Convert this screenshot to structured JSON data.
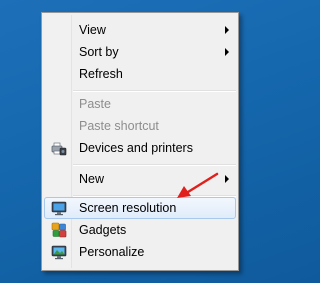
{
  "context_menu": {
    "items": [
      {
        "label": "View",
        "enabled": true,
        "submenu": true
      },
      {
        "label": "Sort by",
        "enabled": true,
        "submenu": true
      },
      {
        "label": "Refresh",
        "enabled": true,
        "submenu": false
      },
      {
        "label": "Paste",
        "enabled": false,
        "submenu": false
      },
      {
        "label": "Paste shortcut",
        "enabled": false,
        "submenu": false
      },
      {
        "label": "Devices and printers",
        "enabled": true,
        "submenu": false,
        "icon": "devices-printers-icon"
      },
      {
        "label": "New",
        "enabled": true,
        "submenu": true
      },
      {
        "label": "Screen resolution",
        "enabled": true,
        "submenu": false,
        "icon": "screen-resolution-icon",
        "highlighted": true
      },
      {
        "label": "Gadgets",
        "enabled": true,
        "submenu": false,
        "icon": "gadgets-icon"
      },
      {
        "label": "Personalize",
        "enabled": true,
        "submenu": false,
        "icon": "personalize-icon"
      }
    ]
  },
  "annotation": {
    "icon": "red-arrow-icon",
    "color": "#e0201b"
  },
  "colors": {
    "desktop": "#1567ad",
    "menu_bg": "#f0f0f0",
    "highlight_border": "#a9c8ed",
    "disabled_text": "#8d8d8d"
  }
}
